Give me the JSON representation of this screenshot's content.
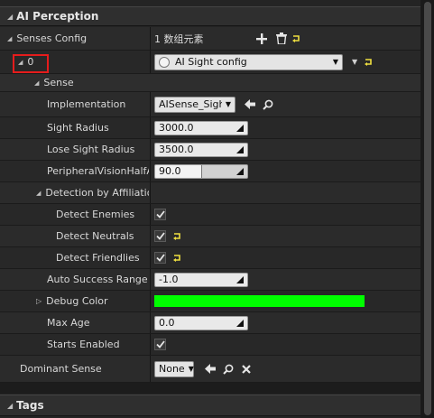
{
  "sections": {
    "ai_perception": "AI Perception",
    "tags": "Tags"
  },
  "senses_config": {
    "label": "Senses Config",
    "value": "1 数组元素"
  },
  "element_0": {
    "label": "0",
    "selected": "AI Sight config"
  },
  "sense": {
    "label": "Sense",
    "implementation": {
      "label": "Implementation",
      "value": "AISense_Sight"
    },
    "sight_radius": {
      "label": "Sight Radius",
      "value": "3000.0"
    },
    "lose_sight_radius": {
      "label": "Lose Sight Radius",
      "value": "3500.0"
    },
    "peripheral": {
      "label": "PeripheralVisionHalfAn",
      "value": "90.0",
      "fill_fraction": 0.5
    },
    "detection": {
      "label": "Detection by Affiliation",
      "enemies": {
        "label": "Detect Enemies",
        "checked": true
      },
      "neutrals": {
        "label": "Detect Neutrals",
        "checked": true
      },
      "friendlies": {
        "label": "Detect Friendlies",
        "checked": true
      }
    },
    "auto_success": {
      "label": "Auto Success Range fr",
      "value": "-1.0"
    },
    "debug_color": {
      "label": "Debug Color",
      "color": "#00ff00"
    },
    "max_age": {
      "label": "Max Age",
      "value": "0.0"
    },
    "starts_enabled": {
      "label": "Starts Enabled",
      "checked": true
    }
  },
  "dominant_sense": {
    "label": "Dominant Sense",
    "value": "None"
  },
  "colors": {
    "panel_bg": "#242424",
    "highlight": "#e51c1c",
    "reset_arrow": "#f0e040",
    "debug_green": "#00ff00"
  }
}
